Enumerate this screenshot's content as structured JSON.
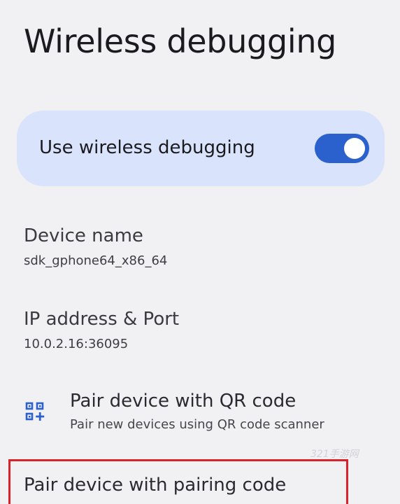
{
  "page": {
    "title": "Wireless debugging"
  },
  "main_switch": {
    "label": "Use wireless debugging",
    "checked": true,
    "accent_color": "#2b61cc",
    "card_color": "#d9e3fb"
  },
  "device_name": {
    "title": "Device name",
    "value": "sdk_gphone64_x86_64"
  },
  "ip_address": {
    "title": "IP address & Port",
    "value": "10.0.2.16:36095"
  },
  "pair_qr": {
    "icon": "qr-code-scanner-icon",
    "title": "Pair device with QR code",
    "summary": "Pair new devices using QR code scanner"
  },
  "pair_code": {
    "title": "Pair device with pairing code",
    "highlight_color": "#d8232a"
  },
  "watermark": {
    "text": "321手游网"
  }
}
